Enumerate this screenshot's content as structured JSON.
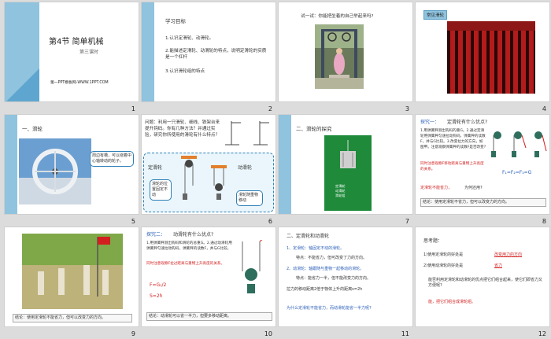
{
  "slides": [
    {
      "num": "1",
      "title": "第4节 简单机械",
      "sub": "第三课时",
      "footer": "第一PPT模板网-WWW.1PPT.COM"
    },
    {
      "num": "2",
      "heading": "学习目标",
      "items": [
        "1.认识定滑轮、动滑轮。",
        "2.能描述定滑轮、动滑轮的特点，说明定滑轮的实质是一个杠杆",
        "3.认识滑轮组的特点"
      ]
    },
    {
      "num": "3",
      "question": "试一试：你能把坐着的自己举起来吗?"
    },
    {
      "num": "4",
      "tag": "常见滑轮"
    },
    {
      "num": "5",
      "heading": "一、滑轮",
      "bubble": "周边有槽，可以绕着中心轴转动的轮子。"
    },
    {
      "num": "6",
      "question": "问题：利用一只滑轮、细线、铁架台来提升钩码。你有几种方法？并通过实验，研究你所使用的滑轮有什么特点？",
      "fixed": "定滑轮",
      "moving": "动滑轮",
      "c1": "滑轮的位置固定不动",
      "c2": "滑轮随重物移动"
    },
    {
      "num": "7",
      "heading": "二、滑轮的探究",
      "pic": [
        "定滑轮",
        "动滑轮",
        "滑轮组"
      ]
    },
    {
      "num": "8",
      "title": "探究一：",
      "title2": "定滑轮有什么优点?",
      "body": "1.用弹簧秤测出钩码的重G。2.通过定滑轮用弹簧秤匀速拉动钩码，弹簧秤的读数F，并与G比较。3.改变拉力的方向，如图甲。注意观察弹簧秤的读数F是否改变?",
      "red": "同时注意观察F移动距离与重物上升高度的关系。",
      "eq": "F₁=F₂=F₃=G",
      "red2": "定滑轮不能省力，",
      "q2": "为何还用?",
      "concl": "结论：使用定滑轮不省力，但可以改变力的方向。"
    },
    {
      "num": "9",
      "concl": "结论：使用定滑轮不能省力，但可以改变力的方向。"
    },
    {
      "num": "10",
      "title": "探究二：",
      "title2": "动滑轮有什么优点?",
      "body": "1.用弹簧秤测出钩码和滑轮的总重G。2.通过动滑轮用弹簧秤匀速拉动钩码，弹簧秤的读数F，并与G比较。",
      "red": "同时注意观察F拉过距离与重物上升高度的关系。",
      "eq1": "F=G₁/2",
      "eq2": "S=2h",
      "concl": "结论：动滑轮可以省一半力，但要多移动距离。"
    },
    {
      "num": "11",
      "heading": "二、定滑轮和动滑轮",
      "l1": "1、定滑轮：轴固定不动的滑轮。",
      "l2": "特点：不能省力，但可改变了力的方向。",
      "l3": "2、动滑轮：轴跟随与重物一起移动的滑轮。",
      "l4": "特点：能省力一半，但不能改变力的方向。",
      "l5": "拉力的移动距离2倍于物体上升的距离s=2h",
      "q": "为什么定滑轮不能省力，而动滑轮能省一半力呢?"
    },
    {
      "num": "12",
      "heading": "思考题：",
      "l1": "1)使用定滑轮的好处是",
      "a1": "改变用力的方向",
      "l2": "2)使用动滑轮的好处是",
      "a2": "省力",
      "l3": "能否利用定滑轮和动滑轮的优点把它们组合起来，使它们即省力又方便呢?",
      "a3": "能，把它们组合成滑轮组。"
    }
  ],
  "colors": {
    "accent_blue": "#2b5fb8",
    "accent_red": "#d21f1f",
    "sidebar": "#8fc3de",
    "bg": "#dcdcdc"
  }
}
